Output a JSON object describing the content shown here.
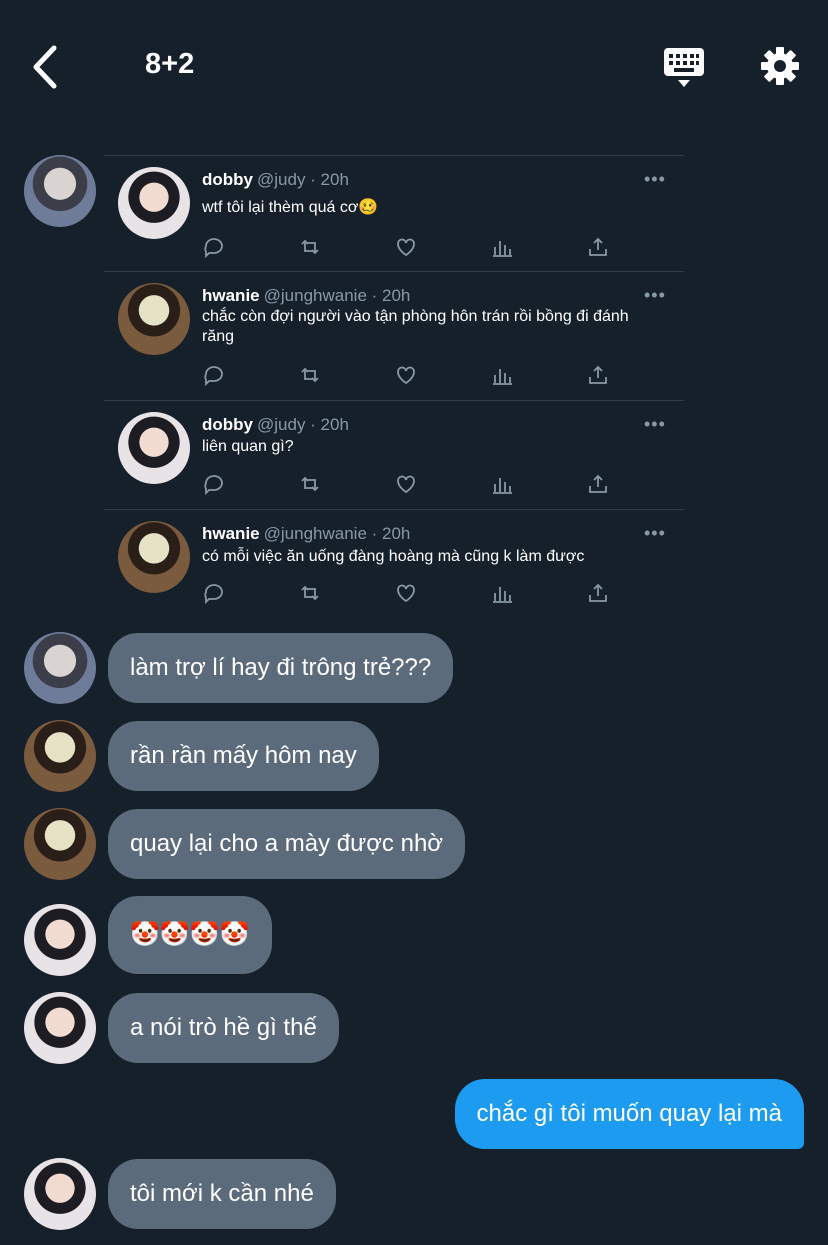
{
  "header": {
    "title": "8+2"
  },
  "icons": {
    "back": "chevron-left-icon",
    "keyboard": "keyboard-icon",
    "settings": "gear-icon"
  },
  "quote_tweets": [
    {
      "name": "dobby",
      "handle": "@judy · 20h",
      "text": "wtf tôi lại thèm quá cơ🥴",
      "more": "•••"
    },
    {
      "name": "hwanie",
      "handle": "@junghwanie · 20h",
      "text": "chắc còn đợi người vào tận phòng hôn trán rồi bồng đi đánh răng",
      "more": "•••"
    },
    {
      "name": "dobby",
      "handle": "@judy · 20h",
      "text": "liên quan gì?",
      "more": "•••"
    },
    {
      "name": "hwanie",
      "handle": "@junghwanie · 20h",
      "text": "có mỗi việc ăn uống đàng hoàng mà cũng k làm được",
      "more": "•••"
    }
  ],
  "messages": [
    {
      "text": "làm trợ lí hay đi trông trẻ???"
    },
    {
      "text": "rần rần mấy hôm nay"
    },
    {
      "text": "quay lại cho a mày được nhờ"
    },
    {
      "text": "🤡🤡🤡🤡"
    },
    {
      "text": "a nói trò hề gì thế"
    },
    {
      "text": "chắc gì tôi muốn quay lại mà"
    },
    {
      "text": "tôi mới k cần nhé"
    }
  ],
  "colors": {
    "background": "#15202b",
    "incoming_bubble": "#5b6b7c",
    "outgoing_bubble": "#1d9bf0",
    "secondary_text": "#8899a6"
  }
}
